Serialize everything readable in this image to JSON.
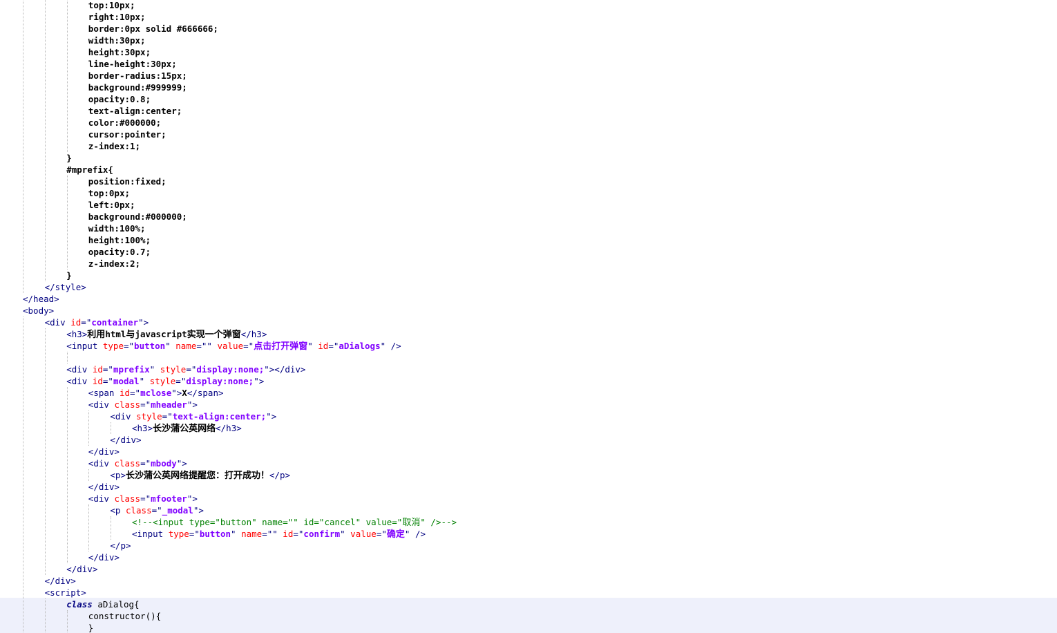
{
  "editor": {
    "language": "html",
    "current_line_index": 51,
    "lines": [
      {
        "indent": 3,
        "segments": [
          {
            "t": "top:10px;",
            "s": "plain"
          }
        ]
      },
      {
        "indent": 3,
        "segments": [
          {
            "t": "right:10px;",
            "s": "plain"
          }
        ]
      },
      {
        "indent": 3,
        "segments": [
          {
            "t": "border:0px solid #666666;",
            "s": "plain"
          }
        ]
      },
      {
        "indent": 3,
        "segments": [
          {
            "t": "width:30px;",
            "s": "plain"
          }
        ]
      },
      {
        "indent": 3,
        "segments": [
          {
            "t": "height:30px;",
            "s": "plain"
          }
        ]
      },
      {
        "indent": 3,
        "segments": [
          {
            "t": "line-height:30px;",
            "s": "plain"
          }
        ]
      },
      {
        "indent": 3,
        "segments": [
          {
            "t": "border-radius:15px;",
            "s": "plain"
          }
        ]
      },
      {
        "indent": 3,
        "segments": [
          {
            "t": "background:#999999;",
            "s": "plain"
          }
        ]
      },
      {
        "indent": 3,
        "segments": [
          {
            "t": "opacity:0.8;",
            "s": "plain"
          }
        ]
      },
      {
        "indent": 3,
        "segments": [
          {
            "t": "text-align:center;",
            "s": "plain"
          }
        ]
      },
      {
        "indent": 3,
        "segments": [
          {
            "t": "color:#000000;",
            "s": "plain"
          }
        ]
      },
      {
        "indent": 3,
        "segments": [
          {
            "t": "cursor:pointer;",
            "s": "plain"
          }
        ]
      },
      {
        "indent": 3,
        "segments": [
          {
            "t": "z-index:1;",
            "s": "plain"
          }
        ]
      },
      {
        "indent": 2,
        "segments": [
          {
            "t": "}",
            "s": "plain"
          }
        ]
      },
      {
        "indent": 2,
        "segments": [
          {
            "t": "#mprefix{",
            "s": "plain"
          }
        ]
      },
      {
        "indent": 3,
        "segments": [
          {
            "t": "position:fixed;",
            "s": "plain"
          }
        ]
      },
      {
        "indent": 3,
        "segments": [
          {
            "t": "top:0px;",
            "s": "plain"
          }
        ]
      },
      {
        "indent": 3,
        "segments": [
          {
            "t": "left:0px;",
            "s": "plain"
          }
        ]
      },
      {
        "indent": 3,
        "segments": [
          {
            "t": "background:#000000;",
            "s": "plain"
          }
        ]
      },
      {
        "indent": 3,
        "segments": [
          {
            "t": "width:100%;",
            "s": "plain"
          }
        ]
      },
      {
        "indent": 3,
        "segments": [
          {
            "t": "height:100%;",
            "s": "plain"
          }
        ]
      },
      {
        "indent": 3,
        "segments": [
          {
            "t": "opacity:0.7;",
            "s": "plain"
          }
        ]
      },
      {
        "indent": 3,
        "segments": [
          {
            "t": "z-index:2;",
            "s": "plain"
          }
        ]
      },
      {
        "indent": 2,
        "segments": [
          {
            "t": "}",
            "s": "plain"
          }
        ]
      },
      {
        "indent": 1,
        "segments": [
          {
            "t": "</style>",
            "s": "tag"
          }
        ]
      },
      {
        "indent": 0,
        "segments": [
          {
            "t": "</head>",
            "s": "tag"
          }
        ]
      },
      {
        "indent": 0,
        "segments": [
          {
            "t": "<body>",
            "s": "tag"
          }
        ]
      },
      {
        "indent": 1,
        "segments": [
          {
            "t": "<div ",
            "s": "tag"
          },
          {
            "t": "id",
            "s": "attr"
          },
          {
            "t": "=\"",
            "s": "tag"
          },
          {
            "t": "container",
            "s": "val"
          },
          {
            "t": "\">",
            "s": "tag"
          }
        ]
      },
      {
        "indent": 2,
        "segments": [
          {
            "t": "<h3>",
            "s": "tag"
          },
          {
            "t": "利用html与javascript实现一个弹窗",
            "s": "text"
          },
          {
            "t": "</h3>",
            "s": "tag"
          }
        ]
      },
      {
        "indent": 2,
        "segments": [
          {
            "t": "<input ",
            "s": "tag"
          },
          {
            "t": "type",
            "s": "attr"
          },
          {
            "t": "=\"",
            "s": "tag"
          },
          {
            "t": "button",
            "s": "val"
          },
          {
            "t": "\" ",
            "s": "tag"
          },
          {
            "t": "name",
            "s": "attr"
          },
          {
            "t": "=\"\" ",
            "s": "tag"
          },
          {
            "t": "value",
            "s": "attr"
          },
          {
            "t": "=\"",
            "s": "tag"
          },
          {
            "t": "点击打开弹窗",
            "s": "val"
          },
          {
            "t": "\" ",
            "s": "tag"
          },
          {
            "t": "id",
            "s": "attr"
          },
          {
            "t": "=\"",
            "s": "tag"
          },
          {
            "t": "aDialogs",
            "s": "val"
          },
          {
            "t": "\" />",
            "s": "tag"
          }
        ]
      },
      {
        "indent": 0,
        "segments": []
      },
      {
        "indent": 2,
        "segments": [
          {
            "t": "<div ",
            "s": "tag"
          },
          {
            "t": "id",
            "s": "attr"
          },
          {
            "t": "=\"",
            "s": "tag"
          },
          {
            "t": "mprefix",
            "s": "val"
          },
          {
            "t": "\" ",
            "s": "tag"
          },
          {
            "t": "style",
            "s": "attr"
          },
          {
            "t": "=\"",
            "s": "tag"
          },
          {
            "t": "display:none;",
            "s": "val"
          },
          {
            "t": "\"></div>",
            "s": "tag"
          }
        ]
      },
      {
        "indent": 2,
        "segments": [
          {
            "t": "<div ",
            "s": "tag"
          },
          {
            "t": "id",
            "s": "attr"
          },
          {
            "t": "=\"",
            "s": "tag"
          },
          {
            "t": "modal",
            "s": "val"
          },
          {
            "t": "\" ",
            "s": "tag"
          },
          {
            "t": "style",
            "s": "attr"
          },
          {
            "t": "=\"",
            "s": "tag"
          },
          {
            "t": "display:none;",
            "s": "val"
          },
          {
            "t": "\">",
            "s": "tag"
          }
        ]
      },
      {
        "indent": 3,
        "segments": [
          {
            "t": "<span ",
            "s": "tag"
          },
          {
            "t": "id",
            "s": "attr"
          },
          {
            "t": "=\"",
            "s": "tag"
          },
          {
            "t": "mclose",
            "s": "val"
          },
          {
            "t": "\">",
            "s": "tag"
          },
          {
            "t": "X",
            "s": "text"
          },
          {
            "t": "</span>",
            "s": "tag"
          }
        ]
      },
      {
        "indent": 3,
        "segments": [
          {
            "t": "<div ",
            "s": "tag"
          },
          {
            "t": "class",
            "s": "attr"
          },
          {
            "t": "=\"",
            "s": "tag"
          },
          {
            "t": "mheader",
            "s": "val"
          },
          {
            "t": "\">",
            "s": "tag"
          }
        ]
      },
      {
        "indent": 4,
        "segments": [
          {
            "t": "<div ",
            "s": "tag"
          },
          {
            "t": "style",
            "s": "attr"
          },
          {
            "t": "=\"",
            "s": "tag"
          },
          {
            "t": "text-align:center;",
            "s": "val"
          },
          {
            "t": "\">",
            "s": "tag"
          }
        ]
      },
      {
        "indent": 5,
        "segments": [
          {
            "t": "<h3>",
            "s": "tag"
          },
          {
            "t": "长沙蒲公英网络",
            "s": "text"
          },
          {
            "t": "</h3>",
            "s": "tag"
          }
        ]
      },
      {
        "indent": 4,
        "segments": [
          {
            "t": "</div>",
            "s": "tag"
          }
        ]
      },
      {
        "indent": 3,
        "segments": [
          {
            "t": "</div>",
            "s": "tag"
          }
        ]
      },
      {
        "indent": 3,
        "segments": [
          {
            "t": "<div ",
            "s": "tag"
          },
          {
            "t": "class",
            "s": "attr"
          },
          {
            "t": "=\"",
            "s": "tag"
          },
          {
            "t": "mbody",
            "s": "val"
          },
          {
            "t": "\">",
            "s": "tag"
          }
        ]
      },
      {
        "indent": 4,
        "segments": [
          {
            "t": "<p>",
            "s": "tag"
          },
          {
            "t": "长沙蒲公英网络提醒您：打开成功！",
            "s": "text"
          },
          {
            "t": "</p>",
            "s": "tag"
          }
        ]
      },
      {
        "indent": 3,
        "segments": [
          {
            "t": "</div>",
            "s": "tag"
          }
        ]
      },
      {
        "indent": 3,
        "segments": [
          {
            "t": "<div ",
            "s": "tag"
          },
          {
            "t": "class",
            "s": "attr"
          },
          {
            "t": "=\"",
            "s": "tag"
          },
          {
            "t": "mfooter",
            "s": "val"
          },
          {
            "t": "\">",
            "s": "tag"
          }
        ]
      },
      {
        "indent": 4,
        "segments": [
          {
            "t": "<p ",
            "s": "tag"
          },
          {
            "t": "class",
            "s": "attr"
          },
          {
            "t": "=\"",
            "s": "tag"
          },
          {
            "t": "_modal",
            "s": "val"
          },
          {
            "t": "\">",
            "s": "tag"
          }
        ]
      },
      {
        "indent": 5,
        "segments": [
          {
            "t": "<!--<input type=\"button\" name=\"\" id=\"cancel\" value=\"取消\" />-->",
            "s": "comment"
          }
        ]
      },
      {
        "indent": 5,
        "segments": [
          {
            "t": "<input ",
            "s": "tag"
          },
          {
            "t": "type",
            "s": "attr"
          },
          {
            "t": "=\"",
            "s": "tag"
          },
          {
            "t": "button",
            "s": "val"
          },
          {
            "t": "\" ",
            "s": "tag"
          },
          {
            "t": "name",
            "s": "attr"
          },
          {
            "t": "=\"\" ",
            "s": "tag"
          },
          {
            "t": "id",
            "s": "attr"
          },
          {
            "t": "=\"",
            "s": "tag"
          },
          {
            "t": "confirm",
            "s": "val"
          },
          {
            "t": "\" ",
            "s": "tag"
          },
          {
            "t": "value",
            "s": "attr"
          },
          {
            "t": "=\"",
            "s": "tag"
          },
          {
            "t": "确定",
            "s": "val"
          },
          {
            "t": "\" />",
            "s": "tag"
          }
        ]
      },
      {
        "indent": 4,
        "segments": [
          {
            "t": "</p>",
            "s": "tag"
          }
        ]
      },
      {
        "indent": 3,
        "segments": [
          {
            "t": "</div>",
            "s": "tag"
          }
        ]
      },
      {
        "indent": 2,
        "segments": [
          {
            "t": "</div>",
            "s": "tag"
          }
        ]
      },
      {
        "indent": 1,
        "segments": [
          {
            "t": "</div>",
            "s": "tag"
          }
        ]
      },
      {
        "indent": 1,
        "segments": [
          {
            "t": "<script>",
            "s": "tag"
          }
        ]
      },
      {
        "indent": 2,
        "segments": [
          {
            "t": "class",
            "s": "keyword"
          },
          {
            "t": " aDialog{",
            "s": "js"
          }
        ]
      },
      {
        "indent": 3,
        "segments": [
          {
            "t": "constructor(){",
            "s": "js"
          }
        ]
      },
      {
        "indent": 3,
        "segments": [
          {
            "t": "}",
            "s": "js"
          }
        ]
      }
    ]
  },
  "colors": {
    "tag": "#000080",
    "attr": "#ff0000",
    "value": "#8000ff",
    "comment": "#008000",
    "text": "#000000",
    "current_line_bg": "#eef0fb",
    "indent_guide": "#b8b8b8"
  }
}
